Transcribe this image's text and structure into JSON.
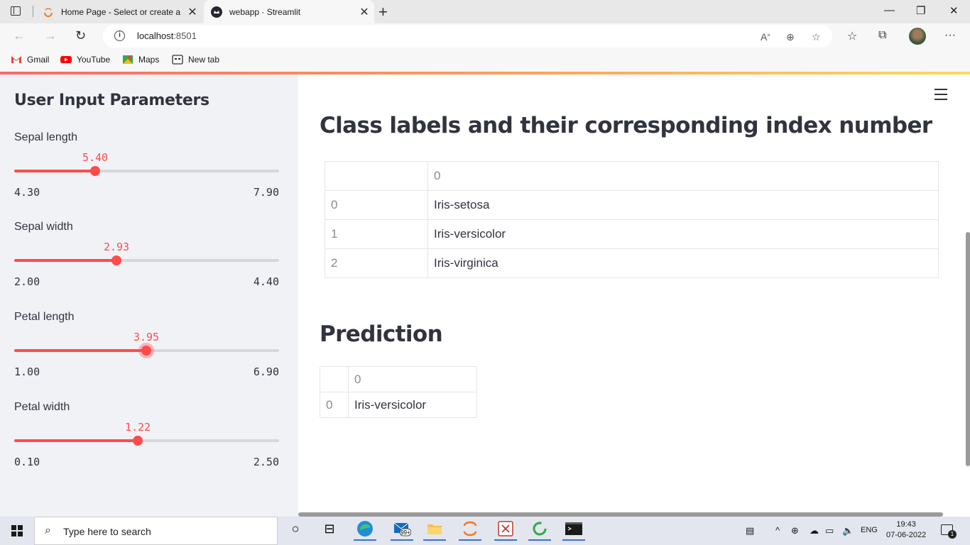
{
  "browser": {
    "tabs": [
      {
        "title": "Home Page - Select or create a n",
        "active": false
      },
      {
        "title": "webapp · Streamlit",
        "active": true
      }
    ],
    "url_host": "localhost",
    "url_port": ":8501",
    "bookmarks": [
      "Gmail",
      "YouTube",
      "Maps",
      "New tab"
    ]
  },
  "sidebar": {
    "title": "User Input Parameters",
    "sliders": [
      {
        "label": "Sepal length",
        "value": "5.40",
        "min": "4.30",
        "max": "7.90",
        "fraction": 0.306
      },
      {
        "label": "Sepal width",
        "value": "2.93",
        "min": "2.00",
        "max": "4.40",
        "fraction": 0.3875
      },
      {
        "label": "Petal length",
        "value": "3.95",
        "min": "1.00",
        "max": "6.90",
        "fraction": 0.5,
        "focused": true
      },
      {
        "label": "Petal width",
        "value": "1.22",
        "min": "0.10",
        "max": "2.50",
        "fraction": 0.4667
      }
    ]
  },
  "main": {
    "class_heading": "Class labels and their corresponding index number",
    "class_table": {
      "header": [
        "",
        "0"
      ],
      "rows": [
        [
          "0",
          "Iris-setosa"
        ],
        [
          "1",
          "Iris-versicolor"
        ],
        [
          "2",
          "Iris-virginica"
        ]
      ]
    },
    "prediction_heading": "Prediction",
    "prediction_table": {
      "header": [
        "",
        "0"
      ],
      "rows": [
        [
          "0",
          "Iris-versicolor"
        ]
      ]
    }
  },
  "taskbar": {
    "search_placeholder": "Type here to search",
    "mail_badge": "99+",
    "lang": "ENG",
    "time": "19:43",
    "date": "07-06-2022",
    "notif_count": "1"
  },
  "colors": {
    "accent": "#ff4b4b",
    "sidebar_bg": "#f0f2f6",
    "text": "#31333f"
  }
}
